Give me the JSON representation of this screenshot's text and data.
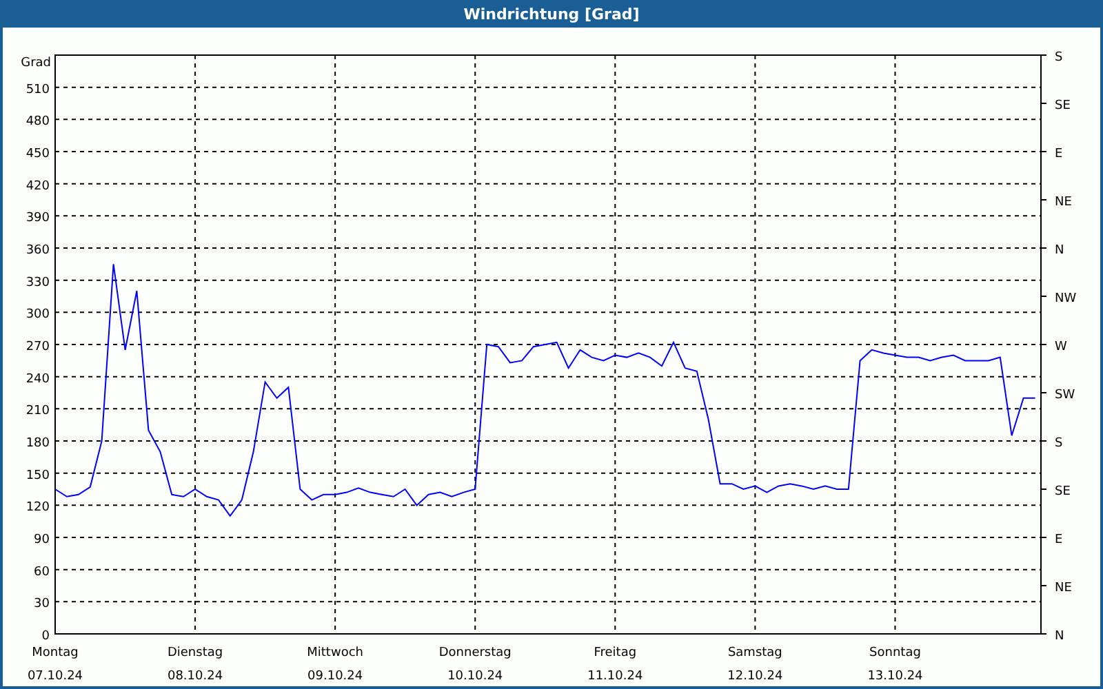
{
  "window": {
    "title": "Windrichtung [Grad]"
  },
  "chart": {
    "chart_data": {
      "type": "line",
      "ylabel": "Grad",
      "grid": true,
      "ylim": [
        0,
        540
      ],
      "yticks": [
        0,
        30,
        60,
        90,
        120,
        150,
        180,
        210,
        240,
        270,
        300,
        330,
        360,
        390,
        420,
        450,
        480,
        510
      ],
      "categories": [
        null,
        null,
        null,
        null,
        null,
        null,
        null,
        null,
        null,
        null,
        null,
        null,
        null,
        null,
        null,
        null,
        null,
        null,
        null,
        null,
        null,
        null,
        null,
        null,
        null,
        null,
        null,
        null,
        null,
        null,
        null,
        null,
        null,
        null,
        null,
        null,
        null,
        null,
        null,
        null,
        null,
        null,
        null,
        null,
        null,
        null,
        null,
        null,
        null,
        null,
        null,
        null,
        null,
        null,
        null,
        null,
        null,
        null,
        null,
        null,
        null,
        null,
        null,
        null,
        null,
        null,
        null,
        null,
        null,
        null,
        null,
        null,
        null,
        null,
        null,
        null,
        null,
        null,
        null,
        null,
        null,
        null,
        null,
        null,
        null
      ],
      "series": [
        {
          "color": "#0000ff",
          "values": [
            135,
            128,
            130,
            137,
            180,
            345,
            265,
            320,
            190,
            170,
            130,
            128,
            135,
            128,
            125,
            110,
            125,
            170,
            235,
            220,
            230,
            135,
            125,
            130,
            130,
            132,
            136,
            132,
            130,
            128,
            135,
            120,
            130,
            132,
            128,
            132,
            135,
            270,
            268,
            253,
            255,
            268,
            270,
            272,
            248,
            265,
            258,
            255,
            260,
            258,
            262,
            258,
            250,
            272,
            248,
            245,
            200,
            140,
            140,
            135,
            138,
            132,
            138,
            140,
            138,
            135,
            138,
            135,
            135,
            255,
            265,
            262,
            260,
            258,
            258,
            255,
            258,
            260,
            255,
            255,
            255,
            258,
            185,
            220,
            220
          ]
        }
      ]
    },
    "days": [
      {
        "name": "Montag",
        "date": "07.10.24"
      },
      {
        "name": "Dienstag",
        "date": "08.10.24"
      },
      {
        "name": "Mittwoch",
        "date": "09.10.24"
      },
      {
        "name": "Donnerstag",
        "date": "10.10.24"
      },
      {
        "name": "Freitag",
        "date": "11.10.24"
      },
      {
        "name": "Samstag",
        "date": "12.10.24"
      },
      {
        "name": "Sonntag",
        "date": "13.10.24"
      }
    ],
    "right_axis_labels": [
      "S",
      "SE",
      "E",
      "NE",
      "N",
      "NW",
      "W",
      "SW",
      "S",
      "SE",
      "E",
      "NE",
      "N"
    ]
  }
}
